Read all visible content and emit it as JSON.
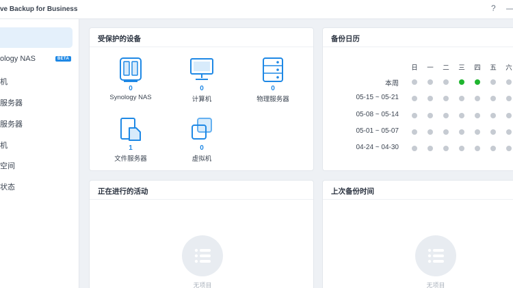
{
  "window": {
    "title": "ve Backup for Business",
    "help": "?",
    "minimize": "—"
  },
  "sidebar": {
    "items": [
      {
        "label": ""
      },
      {
        "label": "ology NAS",
        "badge": "BETA"
      },
      {
        "label": "机"
      },
      {
        "label": "服务器"
      },
      {
        "label": "服务器"
      },
      {
        "label": "机"
      },
      {
        "label": "空间"
      },
      {
        "label": "状态"
      }
    ]
  },
  "protected": {
    "title": "受保护的设备",
    "devices": [
      {
        "icon": "nas-icon",
        "count": "0",
        "label": "Synology NAS"
      },
      {
        "icon": "computer-icon",
        "count": "0",
        "label": "计算机"
      },
      {
        "icon": "physical-server-icon",
        "count": "0",
        "label": "物理服务器"
      },
      {
        "icon": "file-server-icon",
        "count": "1",
        "label": "文件服务器"
      },
      {
        "icon": "virtual-machine-icon",
        "count": "0",
        "label": "虚拟机"
      }
    ]
  },
  "calendar": {
    "title": "备份日历",
    "days": [
      "日",
      "一",
      "二",
      "三",
      "四",
      "五",
      "六"
    ],
    "weeks": [
      {
        "label": "本周",
        "status": [
          "gray",
          "gray",
          "gray",
          "green",
          "green",
          "gray",
          "gray"
        ]
      },
      {
        "label": "05-15 ~ 05-21",
        "status": [
          "gray",
          "gray",
          "gray",
          "gray",
          "gray",
          "gray",
          "gray"
        ]
      },
      {
        "label": "05-08 ~ 05-14",
        "status": [
          "gray",
          "gray",
          "gray",
          "gray",
          "gray",
          "gray",
          "gray"
        ]
      },
      {
        "label": "05-01 ~ 05-07",
        "status": [
          "gray",
          "gray",
          "gray",
          "gray",
          "gray",
          "gray",
          "gray"
        ]
      },
      {
        "label": "04-24 ~ 04-30",
        "status": [
          "gray",
          "gray",
          "gray",
          "gray",
          "gray",
          "gray",
          "gray"
        ]
      }
    ],
    "colors": {
      "gray": "#c6cbd2",
      "green": "#1fb52f"
    }
  },
  "activities": {
    "title": "正在进行的活动",
    "empty": "无项目"
  },
  "last_backup": {
    "title": "上次备份时间",
    "empty": "无项目"
  }
}
